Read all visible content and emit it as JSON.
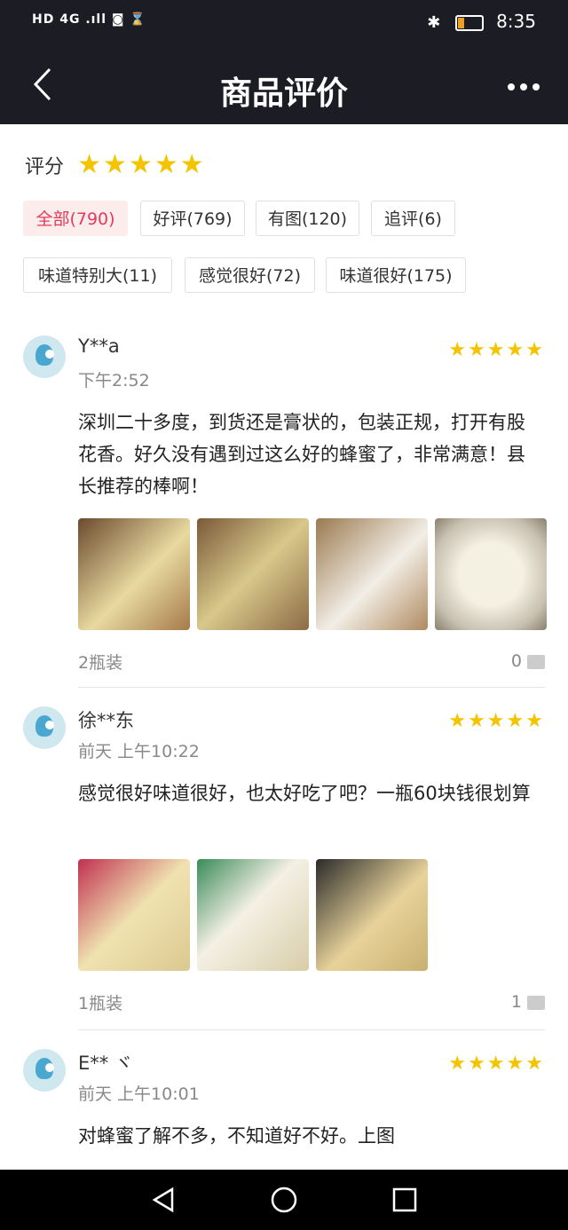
{
  "status_bar": {
    "left": "HD 4G .ıll ◙ ⌛",
    "time": "8:35"
  },
  "header": {
    "title": "商品评价"
  },
  "rating": {
    "label": "评分",
    "stars": 5
  },
  "filters": [
    {
      "label": "全部(790)",
      "active": true
    },
    {
      "label": "好评(769)",
      "active": false
    },
    {
      "label": "有图(120)",
      "active": false
    },
    {
      "label": "追评(6)",
      "active": false
    },
    {
      "label": "味道特别大(11)",
      "active": false
    },
    {
      "label": "感觉很好(72)",
      "active": false
    },
    {
      "label": "味道很好(175)",
      "active": false
    }
  ],
  "reviews": [
    {
      "user": "Y**a",
      "time": "下午2:52",
      "stars": 5,
      "text": "深圳二十多度，到货还是膏状的，包装正规，打开有股花香。好久没有遇到过这么好的蜂蜜了，非常满意！县长推荐的棒啊！",
      "photos": 4,
      "spec": "2瓶装",
      "likes": "0"
    },
    {
      "user": "徐**东",
      "time": "前天 上午10:22",
      "stars": 5,
      "text": "感觉很好味道很好，也太好吃了吧？一瓶60块钱很划算",
      "photos": 3,
      "spec": "1瓶装",
      "likes": "1"
    },
    {
      "user": "E** ヾ",
      "time": "前天 上午10:01",
      "stars": 5,
      "text": "对蜂蜜了解不多，不知道好不好。上图",
      "photos": 0,
      "spec": "",
      "likes": ""
    }
  ],
  "colors": {
    "header_bg": "#1c1c24",
    "star": "#f5c400",
    "active_tag": "#e5395a"
  }
}
